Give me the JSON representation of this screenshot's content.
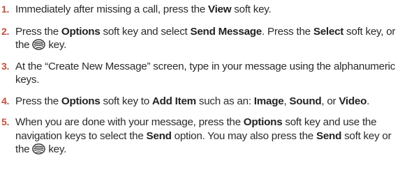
{
  "steps": [
    {
      "number": "1.",
      "parts": {
        "t1": "Immediately after missing a call, press the ",
        "b1": "View",
        "t2": " soft key."
      }
    },
    {
      "number": "2.",
      "parts": {
        "t1": "Press the ",
        "b1": "Options",
        "t2": " soft key and select ",
        "b2": "Send Message",
        "t3": ". Press the ",
        "b3": "Select",
        "t4": " soft key, or the ",
        "icon": "ok-key-icon",
        "t5": " key."
      }
    },
    {
      "number": "3.",
      "parts": {
        "t1": "At the “Create New Message” screen, type in your message using the alphanumeric keys."
      }
    },
    {
      "number": "4.",
      "parts": {
        "t1": "Press the ",
        "b1": "Options",
        "t2": " soft key to ",
        "b2": "Add Item",
        "t3": " such as an: ",
        "b3": "Image",
        "t4": ", ",
        "b4": "Sound",
        "t5": ", or ",
        "b5": "Video",
        "t6": "."
      }
    },
    {
      "number": "5.",
      "parts": {
        "t1": "When you are done with your message, press the ",
        "b1": "Options",
        "t2": " soft key and use the navigation keys to  select the  ",
        "b2": "Send",
        "t3": " option.  You may also press the ",
        "b3": "Send",
        "t4": " soft key or the ",
        "icon": "ok-key-icon",
        "t5": " key."
      }
    }
  ],
  "colors": {
    "number": "#c0503c",
    "text": "#2b2b2b"
  }
}
